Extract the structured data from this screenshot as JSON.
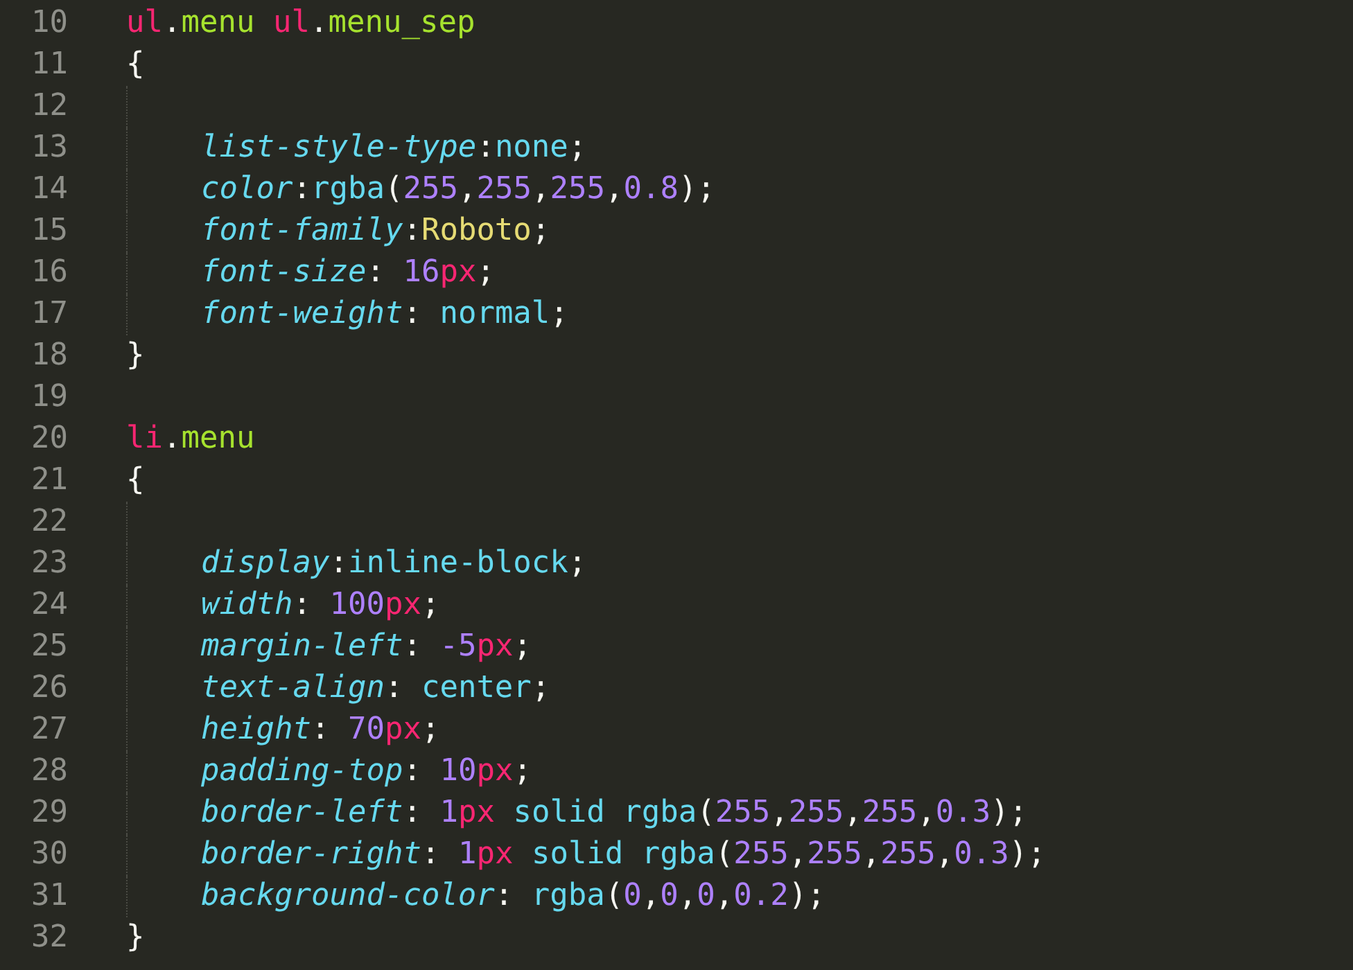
{
  "lines": [
    {
      "number": "10",
      "tokens": [
        {
          "kind": "tag",
          "text": "ul"
        },
        {
          "kind": "punct",
          "text": "."
        },
        {
          "kind": "class",
          "text": "menu"
        },
        {
          "kind": "tag",
          "text": " ul"
        },
        {
          "kind": "punct",
          "text": "."
        },
        {
          "kind": "class",
          "text": "menu_sep"
        }
      ]
    },
    {
      "number": "11",
      "tokens": [
        {
          "kind": "brace_open",
          "text": "{"
        }
      ]
    },
    {
      "number": "12"
    },
    {
      "number": "13",
      "tokens": [
        {
          "kind": "prop",
          "text": "list-style-type"
        },
        {
          "kind": "punct",
          "text": ":"
        },
        {
          "kind": "value",
          "text": "none"
        },
        {
          "kind": "punct",
          "text": ";"
        }
      ]
    },
    {
      "number": "14",
      "tokens": [
        {
          "kind": "prop",
          "text": "color"
        },
        {
          "kind": "punct",
          "text": ":"
        },
        {
          "kind": "value",
          "text": "rgba"
        },
        {
          "kind": "punct",
          "text": "("
        },
        {
          "kind": "number",
          "text": "255"
        },
        {
          "kind": "punct",
          "text": ","
        },
        {
          "kind": "number",
          "text": "255"
        },
        {
          "kind": "punct",
          "text": ","
        },
        {
          "kind": "number",
          "text": "255"
        },
        {
          "kind": "punct",
          "text": ","
        },
        {
          "kind": "number",
          "text": "0.8"
        },
        {
          "kind": "punct",
          "text": ");"
        }
      ]
    },
    {
      "number": "15",
      "tokens": [
        {
          "kind": "prop",
          "text": "font-family"
        },
        {
          "kind": "punct",
          "text": ":"
        },
        {
          "kind": "string",
          "text": "Roboto"
        },
        {
          "kind": "punct",
          "text": ";"
        }
      ]
    },
    {
      "number": "16",
      "tokens": [
        {
          "kind": "prop",
          "text": "font-size"
        },
        {
          "kind": "punct",
          "text": ": "
        },
        {
          "kind": "number",
          "text": "16"
        },
        {
          "kind": "unit",
          "text": "px"
        },
        {
          "kind": "punct",
          "text": ";"
        }
      ]
    },
    {
      "number": "17",
      "tokens": [
        {
          "kind": "prop",
          "text": "font-weight"
        },
        {
          "kind": "punct",
          "text": ": "
        },
        {
          "kind": "value",
          "text": "normal"
        },
        {
          "kind": "punct",
          "text": ";"
        }
      ]
    },
    {
      "number": "18",
      "tokens": [
        {
          "kind": "brace_close",
          "text": "}"
        }
      ]
    },
    {
      "number": "19"
    },
    {
      "number": "20",
      "tokens": [
        {
          "kind": "tag",
          "text": "li"
        },
        {
          "kind": "punct",
          "text": "."
        },
        {
          "kind": "class",
          "text": "menu"
        }
      ]
    },
    {
      "number": "21",
      "tokens": [
        {
          "kind": "brace_open",
          "text": "{"
        }
      ]
    },
    {
      "number": "22"
    },
    {
      "number": "23",
      "tokens": [
        {
          "kind": "prop",
          "text": "display"
        },
        {
          "kind": "punct",
          "text": ":"
        },
        {
          "kind": "value",
          "text": "inline-block"
        },
        {
          "kind": "punct",
          "text": ";"
        }
      ]
    },
    {
      "number": "24",
      "tokens": [
        {
          "kind": "prop",
          "text": "width"
        },
        {
          "kind": "punct",
          "text": ": "
        },
        {
          "kind": "number",
          "text": "100"
        },
        {
          "kind": "unit",
          "text": "px"
        },
        {
          "kind": "punct",
          "text": ";"
        }
      ]
    },
    {
      "number": "25",
      "tokens": [
        {
          "kind": "prop",
          "text": "margin-left"
        },
        {
          "kind": "punct",
          "text": ": "
        },
        {
          "kind": "number",
          "text": "-5"
        },
        {
          "kind": "unit",
          "text": "px"
        },
        {
          "kind": "punct",
          "text": ";"
        }
      ]
    },
    {
      "number": "26",
      "tokens": [
        {
          "kind": "prop",
          "text": "text-align"
        },
        {
          "kind": "punct",
          "text": ": "
        },
        {
          "kind": "value",
          "text": "center"
        },
        {
          "kind": "punct",
          "text": ";"
        }
      ]
    },
    {
      "number": "27",
      "tokens": [
        {
          "kind": "prop",
          "text": "height"
        },
        {
          "kind": "punct",
          "text": ": "
        },
        {
          "kind": "number",
          "text": "70"
        },
        {
          "kind": "unit",
          "text": "px"
        },
        {
          "kind": "punct",
          "text": ";"
        }
      ]
    },
    {
      "number": "28",
      "tokens": [
        {
          "kind": "prop",
          "text": "padding-top"
        },
        {
          "kind": "punct",
          "text": ": "
        },
        {
          "kind": "number",
          "text": "10"
        },
        {
          "kind": "unit",
          "text": "px"
        },
        {
          "kind": "punct",
          "text": ";"
        }
      ]
    },
    {
      "number": "29",
      "tokens": [
        {
          "kind": "prop",
          "text": "border-left"
        },
        {
          "kind": "punct",
          "text": ": "
        },
        {
          "kind": "number",
          "text": "1"
        },
        {
          "kind": "unit",
          "text": "px"
        },
        {
          "kind": "value",
          "text": " solid rgba"
        },
        {
          "kind": "punct",
          "text": "("
        },
        {
          "kind": "number",
          "text": "255"
        },
        {
          "kind": "punct",
          "text": ","
        },
        {
          "kind": "number",
          "text": "255"
        },
        {
          "kind": "punct",
          "text": ","
        },
        {
          "kind": "number",
          "text": "255"
        },
        {
          "kind": "punct",
          "text": ","
        },
        {
          "kind": "number",
          "text": "0.3"
        },
        {
          "kind": "punct",
          "text": ");"
        }
      ]
    },
    {
      "number": "30",
      "tokens": [
        {
          "kind": "prop",
          "text": "border-right"
        },
        {
          "kind": "punct",
          "text": ": "
        },
        {
          "kind": "number",
          "text": "1"
        },
        {
          "kind": "unit",
          "text": "px"
        },
        {
          "kind": "value",
          "text": " solid rgba"
        },
        {
          "kind": "punct",
          "text": "("
        },
        {
          "kind": "number",
          "text": "255"
        },
        {
          "kind": "punct",
          "text": ","
        },
        {
          "kind": "number",
          "text": "255"
        },
        {
          "kind": "punct",
          "text": ","
        },
        {
          "kind": "number",
          "text": "255"
        },
        {
          "kind": "punct",
          "text": ","
        },
        {
          "kind": "number",
          "text": "0.3"
        },
        {
          "kind": "punct",
          "text": ");"
        }
      ]
    },
    {
      "number": "31",
      "tokens": [
        {
          "kind": "prop",
          "text": "background-color"
        },
        {
          "kind": "punct",
          "text": ": "
        },
        {
          "kind": "value",
          "text": "rgba"
        },
        {
          "kind": "punct",
          "text": "("
        },
        {
          "kind": "number",
          "text": "0"
        },
        {
          "kind": "punct",
          "text": ","
        },
        {
          "kind": "number",
          "text": "0"
        },
        {
          "kind": "punct",
          "text": ","
        },
        {
          "kind": "number",
          "text": "0"
        },
        {
          "kind": "punct",
          "text": ","
        },
        {
          "kind": "number",
          "text": "0.2"
        },
        {
          "kind": "punct",
          "text": ");"
        }
      ]
    },
    {
      "number": "32",
      "tokens": [
        {
          "kind": "brace_close",
          "text": "}"
        }
      ]
    }
  ]
}
